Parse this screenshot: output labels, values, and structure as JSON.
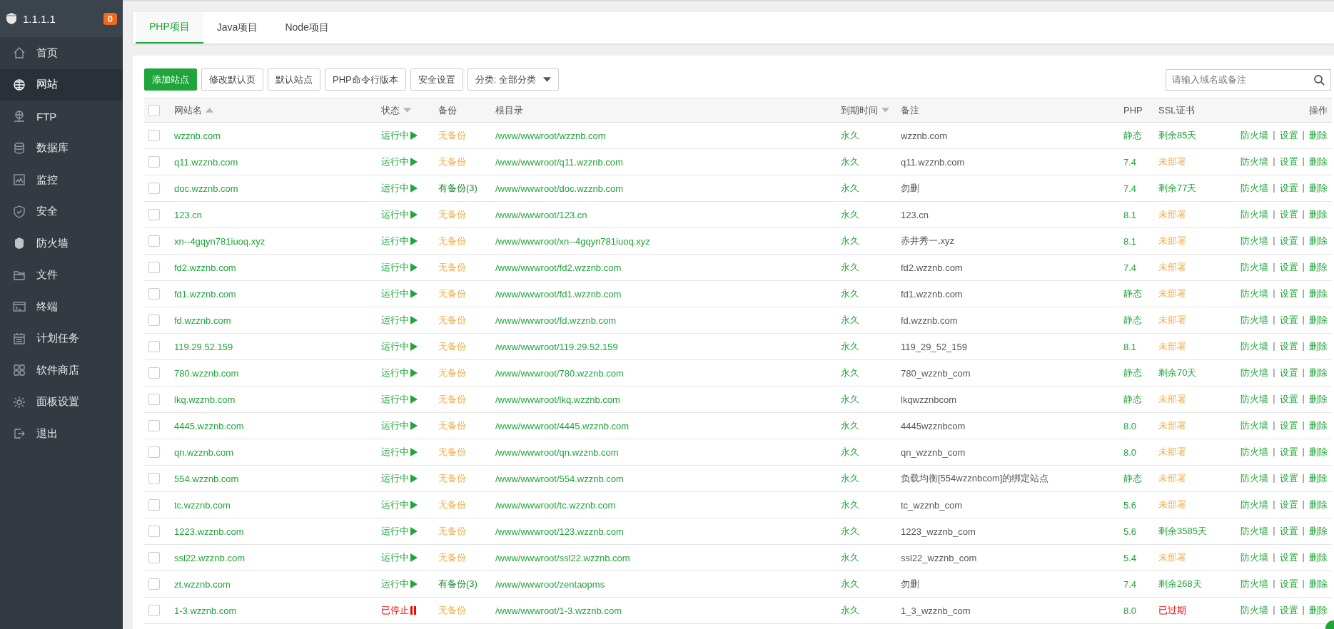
{
  "sidebar": {
    "title": "1.1.1.1",
    "badge": "0",
    "items": [
      {
        "label": "首页",
        "selected": false
      },
      {
        "label": "网站",
        "selected": true
      },
      {
        "label": "FTP",
        "selected": false
      },
      {
        "label": "数据库",
        "selected": false
      },
      {
        "label": "监控",
        "selected": false
      },
      {
        "label": "安全",
        "selected": false
      },
      {
        "label": "防火墙",
        "selected": false
      },
      {
        "label": "文件",
        "selected": false
      },
      {
        "label": "终端",
        "selected": false
      },
      {
        "label": "计划任务",
        "selected": false
      },
      {
        "label": "软件商店",
        "selected": false
      },
      {
        "label": "面板设置",
        "selected": false
      },
      {
        "label": "退出",
        "selected": false
      }
    ]
  },
  "tabs": [
    {
      "label": "PHP项目",
      "selected": true
    },
    {
      "label": "Java项目",
      "selected": false
    },
    {
      "label": "Node项目",
      "selected": false
    }
  ],
  "toolbar": {
    "buttons": [
      {
        "label": "添加站点",
        "kind": "primary"
      },
      {
        "label": "修改默认页",
        "kind": "plain"
      },
      {
        "label": "默认站点",
        "kind": "plain"
      },
      {
        "label": "PHP命令行版本",
        "kind": "plain"
      },
      {
        "label": "安全设置",
        "kind": "plain"
      }
    ],
    "category": {
      "value": "分类: 全部分类"
    },
    "search": {
      "placeholder": "请输入域名或备注"
    }
  },
  "table": {
    "select_all": {
      "checked": false
    },
    "columns": [
      {
        "label": "网站名",
        "sort_arrow": true,
        "ascending": true
      },
      {
        "label": "状态",
        "sort_arrow": true,
        "ascending": false
      },
      {
        "label": "备份",
        "sort_arrow": false
      },
      {
        "label": "根目录",
        "sort_arrow": false
      },
      {
        "label": "到期时间",
        "sort_arrow": true,
        "ascending": false
      },
      {
        "label": "备注",
        "sort_arrow": false
      },
      {
        "label": "PHP",
        "sort_arrow": false
      },
      {
        "label": "SSL证书",
        "sort_arrow": false
      },
      {
        "label": "操作",
        "sort_arrow": false
      }
    ],
    "rows": [
      {
        "checked": false,
        "name": "wzznb.com",
        "status": "运行中",
        "running": true,
        "backup": "无备份",
        "has_backup": false,
        "root": "/www/wwwroot/wzznb.com",
        "expiry": "永久",
        "note": "wzznb.com",
        "php": "静态",
        "ssl": "剩余85天",
        "ssl_deployed": true,
        "ssl_expired": false,
        "actions": [
          "防火墙",
          "设置",
          "删除"
        ],
        "separators": [
          "|",
          "|"
        ]
      },
      {
        "checked": false,
        "name": "q11.wzznb.com",
        "status": "运行中",
        "running": true,
        "backup": "无备份",
        "has_backup": false,
        "root": "/www/wwwroot/q11.wzznb.com",
        "expiry": "永久",
        "note": "q11.wzznb.com",
        "php": "7.4",
        "ssl": "未部署",
        "ssl_deployed": false,
        "ssl_expired": false,
        "actions": [
          "防火墙",
          "设置",
          "删除"
        ],
        "separators": [
          "|",
          "|"
        ]
      },
      {
        "checked": false,
        "name": "doc.wzznb.com",
        "status": "运行中",
        "running": true,
        "backup": "有备份(3)",
        "has_backup": true,
        "root": "/www/wwwroot/doc.wzznb.com",
        "expiry": "永久",
        "note": "勿删",
        "php": "7.4",
        "ssl": "剩余77天",
        "ssl_deployed": true,
        "ssl_expired": false,
        "actions": [
          "防火墙",
          "设置",
          "删除"
        ],
        "separators": [
          "|",
          "|"
        ]
      },
      {
        "checked": false,
        "name": "123.cn",
        "status": "运行中",
        "running": true,
        "backup": "无备份",
        "has_backup": false,
        "root": "/www/wwwroot/123.cn",
        "expiry": "永久",
        "note": "123.cn",
        "php": "8.1",
        "ssl": "未部署",
        "ssl_deployed": false,
        "ssl_expired": false,
        "actions": [
          "防火墙",
          "设置",
          "删除"
        ],
        "separators": [
          "|",
          "|"
        ]
      },
      {
        "checked": false,
        "name": "xn--4gqyn781iuoq.xyz",
        "status": "运行中",
        "running": true,
        "backup": "无备份",
        "has_backup": false,
        "root": "/www/wwwroot/xn--4gqyn781iuoq.xyz",
        "expiry": "永久",
        "note": "赤井秀一.xyz",
        "php": "8.1",
        "ssl": "未部署",
        "ssl_deployed": false,
        "ssl_expired": false,
        "actions": [
          "防火墙",
          "设置",
          "删除"
        ],
        "separators": [
          "|",
          "|"
        ]
      },
      {
        "checked": false,
        "name": "fd2.wzznb.com",
        "status": "运行中",
        "running": true,
        "backup": "无备份",
        "has_backup": false,
        "root": "/www/wwwroot/fd2.wzznb.com",
        "expiry": "永久",
        "note": "fd2.wzznb.com",
        "php": "7.4",
        "ssl": "未部署",
        "ssl_deployed": false,
        "ssl_expired": false,
        "actions": [
          "防火墙",
          "设置",
          "删除"
        ],
        "separators": [
          "|",
          "|"
        ]
      },
      {
        "checked": false,
        "name": "fd1.wzznb.com",
        "status": "运行中",
        "running": true,
        "backup": "无备份",
        "has_backup": false,
        "root": "/www/wwwroot/fd1.wzznb.com",
        "expiry": "永久",
        "note": "fd1.wzznb.com",
        "php": "静态",
        "ssl": "未部署",
        "ssl_deployed": false,
        "ssl_expired": false,
        "actions": [
          "防火墙",
          "设置",
          "删除"
        ],
        "separators": [
          "|",
          "|"
        ]
      },
      {
        "checked": false,
        "name": "fd.wzznb.com",
        "status": "运行中",
        "running": true,
        "backup": "无备份",
        "has_backup": false,
        "root": "/www/wwwroot/fd.wzznb.com",
        "expiry": "永久",
        "note": "fd.wzznb.com",
        "php": "静态",
        "ssl": "未部署",
        "ssl_deployed": false,
        "ssl_expired": false,
        "actions": [
          "防火墙",
          "设置",
          "删除"
        ],
        "separators": [
          "|",
          "|"
        ]
      },
      {
        "checked": false,
        "name": "119.29.52.159",
        "status": "运行中",
        "running": true,
        "backup": "无备份",
        "has_backup": false,
        "root": "/www/wwwroot/119.29.52.159",
        "expiry": "永久",
        "note": "119_29_52_159",
        "php": "8.1",
        "ssl": "未部署",
        "ssl_deployed": false,
        "ssl_expired": false,
        "actions": [
          "防火墙",
          "设置",
          "删除"
        ],
        "separators": [
          "|",
          "|"
        ]
      },
      {
        "checked": false,
        "name": "780.wzznb.com",
        "status": "运行中",
        "running": true,
        "backup": "无备份",
        "has_backup": false,
        "root": "/www/wwwroot/780.wzznb.com",
        "expiry": "永久",
        "note": "780_wzznb_com",
        "php": "静态",
        "ssl": "剩余70天",
        "ssl_deployed": true,
        "ssl_expired": false,
        "actions": [
          "防火墙",
          "设置",
          "删除"
        ],
        "separators": [
          "|",
          "|"
        ]
      },
      {
        "checked": false,
        "name": "lkq.wzznb.com",
        "status": "运行中",
        "running": true,
        "backup": "无备份",
        "has_backup": false,
        "root": "/www/wwwroot/lkq.wzznb.com",
        "expiry": "永久",
        "note": "lkqwzznbcom",
        "php": "静态",
        "ssl": "未部署",
        "ssl_deployed": false,
        "ssl_expired": false,
        "actions": [
          "防火墙",
          "设置",
          "删除"
        ],
        "separators": [
          "|",
          "|"
        ]
      },
      {
        "checked": false,
        "name": "4445.wzznb.com",
        "status": "运行中",
        "running": true,
        "backup": "无备份",
        "has_backup": false,
        "root": "/www/wwwroot/4445.wzznb.com",
        "expiry": "永久",
        "note": "4445wzznbcom",
        "php": "8.0",
        "ssl": "未部署",
        "ssl_deployed": false,
        "ssl_expired": false,
        "actions": [
          "防火墙",
          "设置",
          "删除"
        ],
        "separators": [
          "|",
          "|"
        ]
      },
      {
        "checked": false,
        "name": "qn.wzznb.com",
        "status": "运行中",
        "running": true,
        "backup": "无备份",
        "has_backup": false,
        "root": "/www/wwwroot/qn.wzznb.com",
        "expiry": "永久",
        "note": "qn_wzznb_com",
        "php": "8.0",
        "ssl": "未部署",
        "ssl_deployed": false,
        "ssl_expired": false,
        "actions": [
          "防火墙",
          "设置",
          "删除"
        ],
        "separators": [
          "|",
          "|"
        ]
      },
      {
        "checked": false,
        "name": "554.wzznb.com",
        "status": "运行中",
        "running": true,
        "backup": "无备份",
        "has_backup": false,
        "root": "/www/wwwroot/554.wzznb.com",
        "expiry": "永久",
        "note": "负载均衡[554wzznbcom]的绑定站点",
        "php": "静态",
        "ssl": "未部署",
        "ssl_deployed": false,
        "ssl_expired": false,
        "actions": [
          "防火墙",
          "设置",
          "删除"
        ],
        "separators": [
          "|",
          "|"
        ]
      },
      {
        "checked": false,
        "name": "tc.wzznb.com",
        "status": "运行中",
        "running": true,
        "backup": "无备份",
        "has_backup": false,
        "root": "/www/wwwroot/tc.wzznb.com",
        "expiry": "永久",
        "note": "tc_wzznb_com",
        "php": "5.6",
        "ssl": "未部署",
        "ssl_deployed": false,
        "ssl_expired": false,
        "actions": [
          "防火墙",
          "设置",
          "删除"
        ],
        "separators": [
          "|",
          "|"
        ]
      },
      {
        "checked": false,
        "name": "1223.wzznb.com",
        "status": "运行中",
        "running": true,
        "backup": "无备份",
        "has_backup": false,
        "root": "/www/wwwroot/123.wzznb.com",
        "expiry": "永久",
        "note": "1223_wzznb_com",
        "php": "5.6",
        "ssl": "剩余3585天",
        "ssl_deployed": true,
        "ssl_expired": false,
        "actions": [
          "防火墙",
          "设置",
          "删除"
        ],
        "separators": [
          "|",
          "|"
        ]
      },
      {
        "checked": false,
        "name": "ssl22.wzznb.com",
        "status": "运行中",
        "running": true,
        "backup": "无备份",
        "has_backup": false,
        "root": "/www/wwwroot/ssl22.wzznb.com",
        "expiry": "永久",
        "note": "ssl22_wzznb_com",
        "php": "5.4",
        "ssl": "未部署",
        "ssl_deployed": false,
        "ssl_expired": false,
        "actions": [
          "防火墙",
          "设置",
          "删除"
        ],
        "separators": [
          "|",
          "|"
        ]
      },
      {
        "checked": false,
        "name": "zt.wzznb.com",
        "status": "运行中",
        "running": true,
        "backup": "有备份(3)",
        "has_backup": true,
        "root": "/www/wwwroot/zentaopms",
        "expiry": "永久",
        "note": "勿删",
        "php": "7.4",
        "ssl": "剩余268天",
        "ssl_deployed": true,
        "ssl_expired": false,
        "actions": [
          "防火墙",
          "设置",
          "删除"
        ],
        "separators": [
          "|",
          "|"
        ]
      },
      {
        "checked": false,
        "name": "1-3.wzznb.com",
        "status": "已停止",
        "running": false,
        "backup": "无备份",
        "has_backup": false,
        "root": "/www/wwwroot/1-3.wzznb.com",
        "expiry": "永久",
        "note": "1_3_wzznb_com",
        "php": "8.0",
        "ssl": "已过期",
        "ssl_deployed": true,
        "ssl_expired": true,
        "actions": [
          "防火墙",
          "设置",
          "删除"
        ],
        "separators": [
          "|",
          "|"
        ]
      }
    ]
  }
}
